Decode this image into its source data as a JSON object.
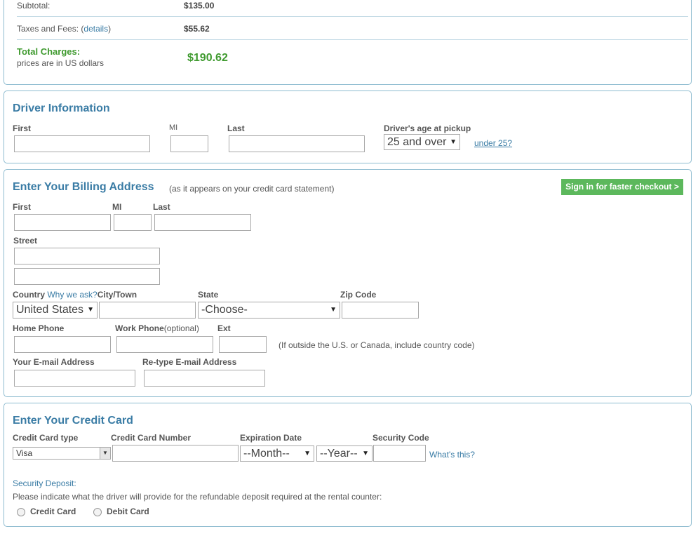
{
  "summary": {
    "subtotal_label": "Subtotal:",
    "subtotal_value": "$135.00",
    "taxes_label": "Taxes and Fees: (",
    "taxes_link": "details",
    "taxes_close": ")",
    "taxes_value": "$55.62",
    "total_label": "Total Charges:",
    "total_note": "prices are in US dollars",
    "total_value": "$190.62"
  },
  "driver": {
    "title": "Driver Information",
    "first_label": "First",
    "mi_label": "MI",
    "last_label": "Last",
    "age_label": "Driver's age at pickup",
    "age_value": "25 and over",
    "under25_link": "under 25?"
  },
  "billing": {
    "title": "Enter Your Billing Address",
    "subtitle": "(as it appears on your credit card statement)",
    "signin_button": "Sign in for faster checkout >",
    "first_label": "First",
    "mi_label": "MI",
    "last_label": "Last",
    "street_label": "Street",
    "country_label": "Country",
    "why_link": "Why we ask?",
    "city_label": "City/Town",
    "state_label": "State",
    "zip_label": "Zip Code",
    "country_value": "United States",
    "state_value": "-Choose-",
    "home_phone_label": "Home Phone",
    "work_phone_label": "Work Phone",
    "work_phone_optional": "(optional)",
    "ext_label": "Ext",
    "phone_note": "(If outside the U.S. or Canada, include country code)",
    "email_label": "Your E-mail Address",
    "retype_email_label": "Re-type E-mail Address"
  },
  "card": {
    "title": "Enter Your Credit Card",
    "type_label": "Credit Card type",
    "number_label": "Credit Card Number",
    "expiration_label": "Expiration Date",
    "security_label": "Security Code",
    "type_value": "Visa",
    "month_value": "--Month--",
    "year_value": "--Year--",
    "whats_this_link": "What's this?",
    "deposit_title": "Security Deposit:",
    "deposit_note": "Please indicate what the driver will provide for the refundable deposit required at the rental counter:",
    "credit_card_option": "Credit Card",
    "debit_card_option": "Debit Card"
  }
}
